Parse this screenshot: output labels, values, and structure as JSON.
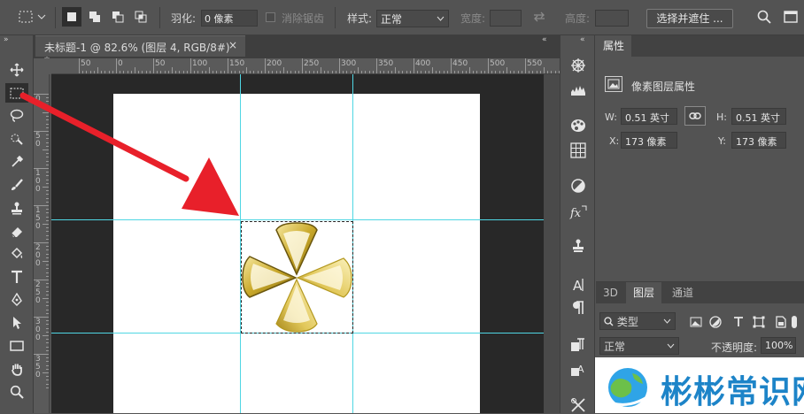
{
  "options_bar": {
    "feather_label": "羽化:",
    "feather_value": "0 像素",
    "antialias_label": "消除锯齿",
    "style_label": "样式:",
    "style_value": "正常",
    "width_label": "宽度:",
    "height_label": "高度:",
    "select_mask_button": "选择并遮住 ..."
  },
  "document": {
    "tab_title": "未标题-1 @ 82.6% (图层 4, RGB/8#) *",
    "close_glyph": "×"
  },
  "ruler": {
    "h_ticks": [
      "50",
      "0",
      "50",
      "100",
      "150",
      "200",
      "250",
      "300",
      "350",
      "400",
      "450",
      "500",
      "550"
    ],
    "v_ticks": [
      "0",
      "5\n0",
      "1\n0\n0",
      "1\n5\n0",
      "2\n0\n0",
      "2\n5\n0",
      "3\n0\n0",
      "3\n5\n0"
    ]
  },
  "properties": {
    "tab_label": "属性",
    "header": "像素图层属性",
    "w_label": "W:",
    "w_value": "0.51 英寸",
    "h_label": "H:",
    "h_value": "0.51 英寸",
    "x_label": "X:",
    "x_value": "173 像素",
    "y_label": "Y:",
    "y_value": "173 像素"
  },
  "layers": {
    "tabs": [
      "3D",
      "图层",
      "通道"
    ],
    "filter_kind": "类型",
    "blend_mode": "正常",
    "opacity_label": "不透明度:",
    "opacity_value": "100%"
  },
  "watermark": {
    "text": "彬彬常识网"
  },
  "colors": {
    "accent_arrow": "#e8202a",
    "guide": "#4fd6e3",
    "gold": "#c9a82a"
  }
}
